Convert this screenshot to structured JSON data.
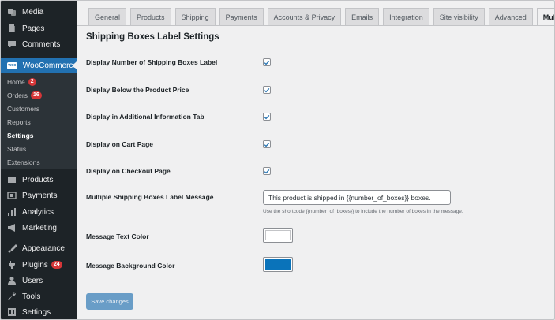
{
  "sidebar": {
    "top_items": [
      {
        "label": "Media",
        "icon": "media-icon"
      },
      {
        "label": "Pages",
        "icon": "pages-icon"
      },
      {
        "label": "Comments",
        "icon": "comments-icon"
      }
    ],
    "woocommerce": {
      "label": "WooCommerce",
      "icon": "woocommerce-icon",
      "icon_text": "woo"
    },
    "submenu": [
      {
        "label": "Home",
        "badge": "2"
      },
      {
        "label": "Orders",
        "badge": "16"
      },
      {
        "label": "Customers"
      },
      {
        "label": "Reports"
      },
      {
        "label": "Settings",
        "current": true
      },
      {
        "label": "Status"
      },
      {
        "label": "Extensions"
      }
    ],
    "bottom_items": [
      {
        "label": "Products",
        "icon": "products-icon"
      },
      {
        "label": "Payments",
        "icon": "payments-icon"
      },
      {
        "label": "Analytics",
        "icon": "analytics-icon"
      },
      {
        "label": "Marketing",
        "icon": "marketing-icon"
      },
      {
        "label": "Appearance",
        "icon": "appearance-icon"
      },
      {
        "label": "Plugins",
        "icon": "plugins-icon",
        "badge": "24"
      },
      {
        "label": "Users",
        "icon": "users-icon"
      },
      {
        "label": "Tools",
        "icon": "tools-icon"
      },
      {
        "label": "Settings",
        "icon": "settings-icon"
      }
    ]
  },
  "tabs": [
    {
      "label": "General"
    },
    {
      "label": "Products"
    },
    {
      "label": "Shipping"
    },
    {
      "label": "Payments"
    },
    {
      "label": "Accounts & Privacy"
    },
    {
      "label": "Emails"
    },
    {
      "label": "Integration"
    },
    {
      "label": "Site visibility"
    },
    {
      "label": "Advanced"
    },
    {
      "label": "Multiple Boxes",
      "active": true
    }
  ],
  "page_title": "Shipping Boxes Label Settings",
  "settings": {
    "checkboxes": [
      {
        "label": "Display Number of Shipping Boxes Label",
        "checked": true
      },
      {
        "label": "Display Below the Product Price",
        "checked": true
      },
      {
        "label": "Display in Additional Information Tab",
        "checked": true
      },
      {
        "label": "Display on Cart Page",
        "checked": true
      },
      {
        "label": "Display on Checkout Page",
        "checked": true
      }
    ],
    "message": {
      "label": "Multiple Shipping Boxes Label Message",
      "value": "This product is shipped in {{number_of_boxes}} boxes.",
      "description": "Use the shortcode {{number_of_boxes}} to include the number of boxes in the message."
    },
    "text_color": {
      "label": "Message Text Color",
      "value": "#ffffff"
    },
    "bg_color": {
      "label": "Message Background Color",
      "value": "#0a73ba"
    }
  },
  "save_button": "Save changes",
  "colors": {
    "accent": "#2271b1",
    "sidebar_bg": "#1d2327",
    "badge": "#d63638"
  }
}
